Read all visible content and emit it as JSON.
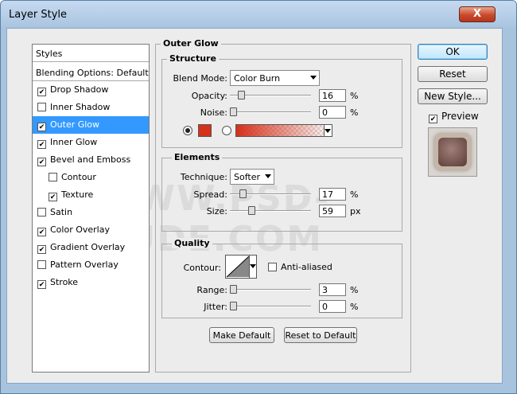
{
  "window": {
    "title": "Layer Style",
    "close_label": "X"
  },
  "watermark": "WWW.PSD-DUDE.COM",
  "styles_list": {
    "header": "Styles",
    "blending": "Blending Options: Default",
    "items": [
      {
        "label": "Drop Shadow",
        "checked": true
      },
      {
        "label": "Inner Shadow",
        "checked": false
      },
      {
        "label": "Outer Glow",
        "checked": true
      },
      {
        "label": "Inner Glow",
        "checked": true
      },
      {
        "label": "Bevel and Emboss",
        "checked": true
      },
      {
        "label": "Contour",
        "checked": false
      },
      {
        "label": "Texture",
        "checked": true
      },
      {
        "label": "Satin",
        "checked": false
      },
      {
        "label": "Color Overlay",
        "checked": true
      },
      {
        "label": "Gradient Overlay",
        "checked": true
      },
      {
        "label": "Pattern Overlay",
        "checked": false
      },
      {
        "label": "Stroke",
        "checked": true
      }
    ]
  },
  "panel": {
    "title": "Outer Glow",
    "structure": {
      "title": "Structure",
      "blend_mode_label": "Blend Mode:",
      "blend_mode_value": "Color Burn",
      "opacity_label": "Opacity:",
      "opacity_value": "16",
      "opacity_unit": "%",
      "noise_label": "Noise:",
      "noise_value": "0",
      "noise_unit": "%",
      "color": "#d5301a"
    },
    "elements": {
      "title": "Elements",
      "technique_label": "Technique:",
      "technique_value": "Softer",
      "spread_label": "Spread:",
      "spread_value": "17",
      "spread_unit": "%",
      "size_label": "Size:",
      "size_value": "59",
      "size_unit": "px"
    },
    "quality": {
      "title": "Quality",
      "contour_label": "Contour:",
      "anti_aliased_label": "Anti-aliased",
      "anti_aliased": false,
      "range_label": "Range:",
      "range_value": "3",
      "range_unit": "%",
      "jitter_label": "Jitter:",
      "jitter_value": "0",
      "jitter_unit": "%"
    },
    "make_default": "Make Default",
    "reset_default": "Reset to Default"
  },
  "buttons": {
    "ok": "OK",
    "reset": "Reset",
    "new_style": "New Style...",
    "preview": "Preview",
    "preview_checked": true
  },
  "colors": {
    "accent": "#3399ff",
    "glow": "#d5301a"
  }
}
